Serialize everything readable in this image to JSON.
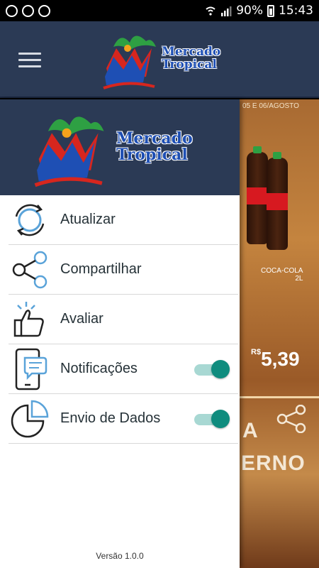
{
  "status_bar": {
    "battery": "90%",
    "time": "15:43"
  },
  "brand": {
    "line1": "Mercado",
    "line2": "Tropical",
    "colors": {
      "primary": "#2b3a55",
      "accent_teal": "#0f8c7e",
      "text_blue": "#1e4fb4"
    }
  },
  "menu": {
    "items": [
      {
        "label": "Atualizar",
        "icon": "refresh-icon"
      },
      {
        "label": "Compartilhar",
        "icon": "share-icon"
      },
      {
        "label": "Avaliar",
        "icon": "thumbs-up-icon"
      },
      {
        "label": "Notificações",
        "icon": "phone-notification-icon",
        "toggle": true,
        "on": true
      },
      {
        "label": "Envio de Dados",
        "icon": "pie-chart-icon",
        "toggle": true,
        "on": true
      }
    ]
  },
  "version": "Versão 1.0.0",
  "background": {
    "date_text": "05 E 06/AGOSTO",
    "product": "COCA-COLA",
    "size": "2L",
    "currency": "R$",
    "price": "5,39",
    "banner_line1": "A",
    "banner_line2": "ERNO"
  }
}
